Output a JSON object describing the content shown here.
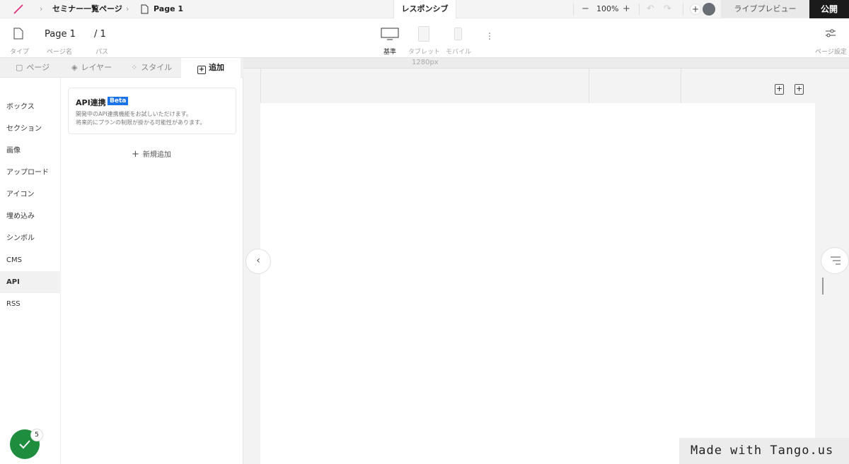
{
  "topbar": {
    "breadcrumb_parent": "セミナー一覧ページ",
    "breadcrumb_page": "Page 1",
    "responsive_tab": "レスポンシブ",
    "zoom_level": "100%",
    "live_preview": "ライブプレビュー",
    "publish": "公開"
  },
  "toolbar": {
    "type_label": "タイプ",
    "page_name_label": "ページ名",
    "page_name": "Page 1",
    "path_label": "パス",
    "path": "/ 1",
    "device_base": "基準",
    "device_tablet": "タブレット",
    "device_mobile": "モバイル",
    "page_settings": "ページ設定"
  },
  "panel": {
    "tabs": [
      "ページ",
      "レイヤー",
      "スタイル",
      "追加"
    ],
    "categories": [
      "ボックス",
      "セクション",
      "画像",
      "アップロード",
      "アイコン",
      "埋め込み",
      "シンボル",
      "CMS",
      "API",
      "RSS"
    ],
    "selected_category": "API",
    "card": {
      "title": "API連携",
      "badge": "Beta",
      "desc_line1": "開発中のAPI連携機能をお試しいただけます。",
      "desc_line2": "将来的にプランの制限が掛かる可能性があります。"
    },
    "new_add": "新規追加"
  },
  "canvas": {
    "ruler_width_label": "1280px"
  },
  "status": {
    "check_count": "5"
  },
  "watermark": "Made with Tango.us",
  "colors": {
    "accent_blue": "#1a73e8",
    "publish_bg": "#1b1b1b",
    "check_green": "#1e8e3e",
    "logo_pink": "#e0267a"
  }
}
